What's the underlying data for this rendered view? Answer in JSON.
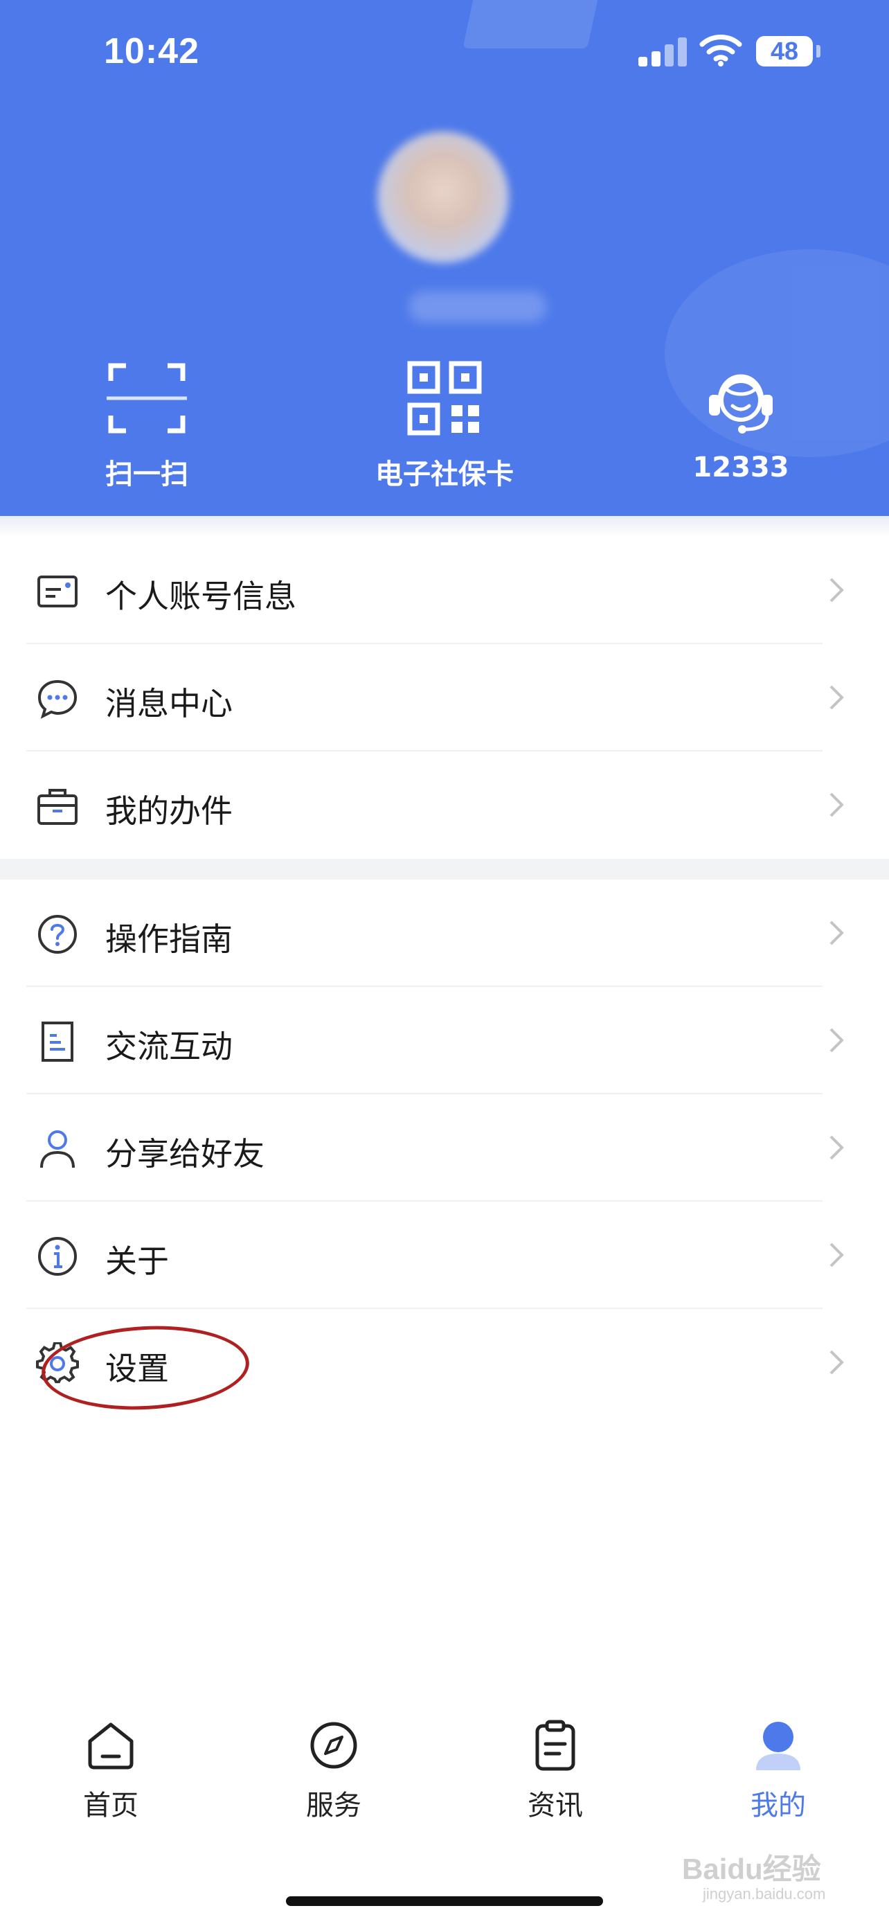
{
  "status_bar": {
    "time": "10:42",
    "battery": "48"
  },
  "colors": {
    "accent": "#4d79ea",
    "highlight_ellipse": "#b12020",
    "tab_inactive": "#222222"
  },
  "quick_actions": [
    {
      "label": "扫一扫",
      "icon": "scan-icon"
    },
    {
      "label": "电子社保卡",
      "icon": "qr-code-icon"
    },
    {
      "label": "12333",
      "icon": "headset-icon"
    }
  ],
  "menu_group_1": [
    {
      "label": "个人账号信息",
      "icon": "id-card-icon"
    },
    {
      "label": "消息中心",
      "icon": "message-icon"
    },
    {
      "label": "我的办件",
      "icon": "briefcase-icon"
    }
  ],
  "menu_group_2": [
    {
      "label": "操作指南",
      "icon": "question-icon"
    },
    {
      "label": "交流互动",
      "icon": "document-icon"
    },
    {
      "label": "分享给好友",
      "icon": "user-icon"
    },
    {
      "label": "关于",
      "icon": "info-icon"
    },
    {
      "label": "设置",
      "icon": "gear-icon"
    }
  ],
  "tabs": [
    {
      "label": "首页",
      "icon": "home-icon"
    },
    {
      "label": "服务",
      "icon": "compass-icon"
    },
    {
      "label": "资讯",
      "icon": "clipboard-icon"
    },
    {
      "label": "我的",
      "icon": "profile-icon",
      "active": true
    }
  ],
  "watermark": {
    "brand": "Baidu经验",
    "url": "jingyan.baidu.com"
  }
}
